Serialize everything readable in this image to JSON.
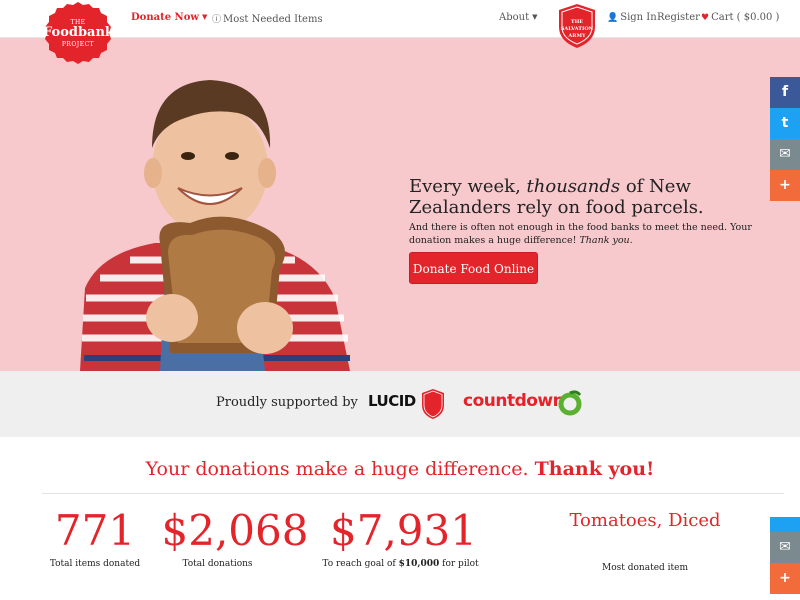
{
  "logo": {
    "line1": "THE",
    "line2": "Foodbank",
    "line3": "PROJECT"
  },
  "nav": {
    "donate_now": "Donate Now",
    "most_needed": "Most Needed Items",
    "about": "About",
    "sign_in": "Sign In",
    "register": "Register",
    "cart": "Cart ( $0.00 )"
  },
  "hero": {
    "heading_pre": "Every week, ",
    "heading_em": "thousands",
    "heading_post": " of New Zealanders rely on food parcels.",
    "sub_text": "And there is often not enough in the food banks to meet the need. Your donation makes a huge difference! ",
    "sub_em": "Thank you.",
    "cta": "Donate Food Online"
  },
  "supported": {
    "label": "Proudly supported by",
    "sponsor_lucid": "LUCID",
    "sponsor_countdown": "countdown"
  },
  "stats": {
    "title_main": "Your donations make a huge difference. ",
    "title_bold": "Thank you!",
    "items": [
      {
        "value": "771",
        "label": "Total items donated"
      },
      {
        "value": "$2,068",
        "label": "Total donations"
      },
      {
        "value": "$7,931",
        "label_pre": "To reach goal of ",
        "label_bold": "$10,000",
        "label_post": " for pilot"
      },
      {
        "value": "Tomatoes, Diced",
        "label": "Most donated item"
      }
    ]
  },
  "social": [
    "facebook-icon",
    "twitter-icon",
    "email-icon",
    "plus-icon"
  ],
  "colors": {
    "accent": "#e3242b",
    "hero_bg": "#f7c8cc",
    "supported_bg": "#efefef"
  }
}
